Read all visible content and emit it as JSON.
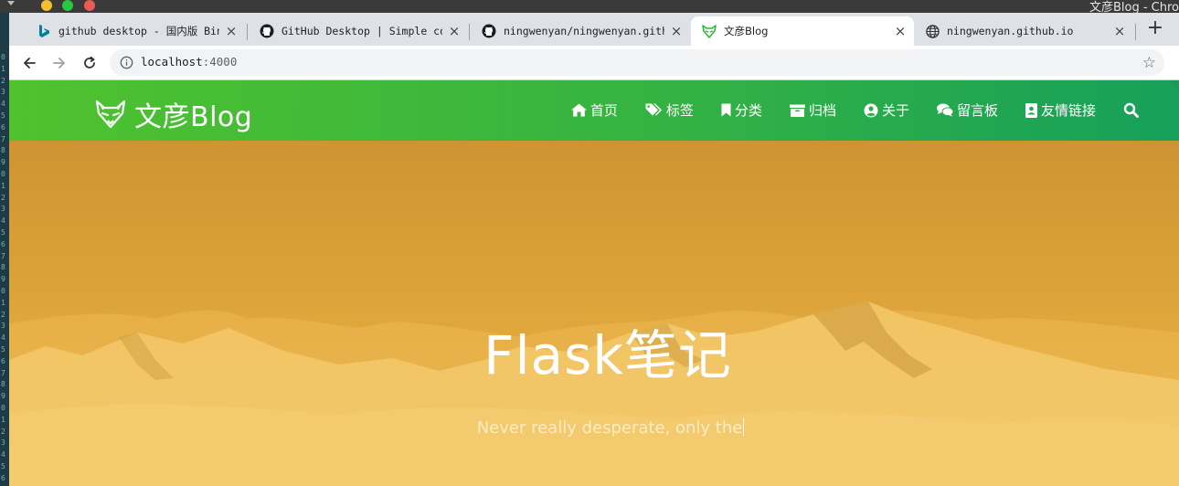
{
  "os": {
    "window_title": "文彦Blog - Chro"
  },
  "gutter": {
    "line_numbers": [
      "0",
      "1",
      "2",
      "3",
      "4",
      "5",
      "6",
      "7",
      "8",
      "9",
      "0",
      "1",
      "2",
      "3",
      "4",
      "5",
      "6",
      "7",
      "8",
      "9",
      "0",
      "1",
      "2",
      "3",
      "4",
      "5",
      "6",
      "7",
      "8",
      "9",
      "0",
      "1",
      "2",
      "3",
      "4",
      "5",
      "6"
    ]
  },
  "tabs": [
    {
      "title": "github desktop - 国内版 Bing",
      "favicon": "bing-icon",
      "close": "×"
    },
    {
      "title": "GitHub Desktop | Simple collaboration",
      "favicon": "github-icon",
      "close": "×"
    },
    {
      "title": "ningwenyan/ningwenyan.github.io",
      "favicon": "github-icon",
      "close": "×"
    },
    {
      "title": "文彦Blog",
      "favicon": "fox-icon",
      "close": "×",
      "active": true
    },
    {
      "title": "ningwenyan.github.io",
      "favicon": "globe-icon",
      "close": "×"
    }
  ],
  "toolbar": {
    "new_tab": "+",
    "url_host": "localhost",
    "url_port": ":4000",
    "bookmark_star": "☆"
  },
  "site": {
    "brand": "文彦Blog",
    "nav": [
      {
        "label": "首页",
        "icon": "home-icon"
      },
      {
        "label": "标签",
        "icon": "tags-icon"
      },
      {
        "label": "分类",
        "icon": "bookmark-icon"
      },
      {
        "label": "归档",
        "icon": "archive-icon"
      },
      {
        "label": "关于",
        "icon": "user-circle-icon"
      },
      {
        "label": "留言板",
        "icon": "comments-icon"
      },
      {
        "label": "友情链接",
        "icon": "contact-card-icon"
      }
    ],
    "search_icon": "search-icon",
    "colors": {
      "navbar_start": "#4fc22e",
      "navbar_end": "#16a05a",
      "hero_tint": "#e1a63a"
    }
  },
  "hero": {
    "title": "Flask笔记",
    "subtitle": "Never really desperate, only the"
  }
}
